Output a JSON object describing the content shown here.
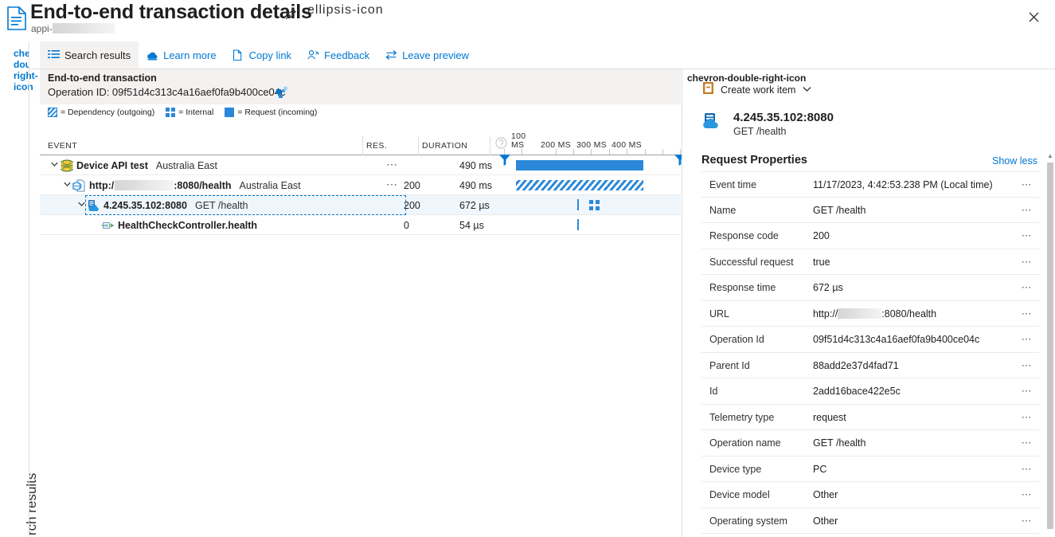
{
  "blade": {
    "title": "End-to-end transaction details",
    "subtitle_prefix": "appi-",
    "doc_icon": "document-icon",
    "pin_icon": "pin-icon",
    "more_icon": "ellipsis-icon",
    "close_icon": "close-icon"
  },
  "left_rail": {
    "expand_icon": "chevron-double-right-icon",
    "vertical_label": "rch results"
  },
  "commandbar": {
    "items": [
      {
        "label": "Search results",
        "icon": "list-icon",
        "active": true
      },
      {
        "label": "Learn more",
        "icon": "cloud-learn-icon",
        "active": false
      },
      {
        "label": "Copy link",
        "icon": "copy-icon",
        "active": false
      },
      {
        "label": "Feedback",
        "icon": "feedback-person-icon",
        "active": false
      },
      {
        "label": "Leave preview",
        "icon": "swap-arrows-icon",
        "active": false
      }
    ]
  },
  "transaction": {
    "heading": "End-to-end transaction",
    "operation_id_label": "Operation ID: 09f51d4c313c4a16aef0fa9b400ce04c",
    "operation_id_copy_icon": "copy-badge-icon",
    "legend": [
      {
        "swatch": "dependency",
        "label": "= Dependency (outgoing)"
      },
      {
        "swatch": "internal",
        "label": "= Internal"
      },
      {
        "swatch": "request",
        "label": "= Request (incoming)"
      }
    ]
  },
  "table": {
    "columns": {
      "event": "EVENT",
      "res": "RES.",
      "duration": "DURATION"
    },
    "search_icon": "search-icon",
    "clock_icon": "clock-icon",
    "filter_icon": "filter-funnel-icon",
    "axis_labels": [
      "100 MS",
      "200 MS",
      "300 MS",
      "400 MS"
    ],
    "rows": [
      {
        "indent": 0,
        "chevron": "⌄",
        "icon": "globe-availability-icon",
        "name": "Device API test",
        "sub": "Australia East",
        "res": "",
        "duration": "490 ms",
        "dots": "⋯",
        "bar_type": "request",
        "selected": false
      },
      {
        "indent": 1,
        "chevron": "⌄",
        "icon": "page-globe-request-icon",
        "name": "http:/  :8080/health",
        "name_prefix": "http:/",
        "name_suffix": ":8080/health",
        "sub": "Australia East",
        "res": "200",
        "duration": "490 ms",
        "dots": "⋯",
        "bar_type": "dependency",
        "selected": false
      },
      {
        "indent": 2,
        "chevron": "⌄",
        "icon": "server-cloud-role-icon",
        "name": "4.245.35.102:8080",
        "sub": "GET /health",
        "res": "200",
        "duration": "672 µs",
        "dots": "",
        "bar_type": "internal-mark",
        "selected": true
      },
      {
        "indent": 3,
        "chevron": "",
        "icon": "internal-trace-icon",
        "name": "HealthCheckController.health",
        "sub": "",
        "res": "0",
        "duration": "54 µs",
        "dots": "",
        "bar_type": "mark",
        "selected": false
      }
    ]
  },
  "details": {
    "expand_icon": "chevron-double-right-icon",
    "create_work_item": {
      "label": "Create work item",
      "icon": "work-item-icon",
      "chevron": "⌄"
    },
    "entity": {
      "icon": "server-cloud-role-icon",
      "title": "4.245.35.102:8080",
      "subtitle": "GET /health"
    },
    "section_title": "Request Properties",
    "show_less": "Show less",
    "row_menu": "⋯",
    "properties": [
      {
        "key": "Event time",
        "value": "11/17/2023, 4:42:53.238 PM (Local time)"
      },
      {
        "key": "Name",
        "value": "GET /health"
      },
      {
        "key": "Response code",
        "value": "200"
      },
      {
        "key": "Successful request",
        "value": "true"
      },
      {
        "key": "Response time",
        "value": "672 µs"
      },
      {
        "key": "URL",
        "value": "http://  :8080/health",
        "value_prefix": "http://",
        "value_suffix": ":8080/health",
        "redacted": true
      },
      {
        "key": "Operation Id",
        "value": "09f51d4c313c4a16aef0fa9b400ce04c"
      },
      {
        "key": "Parent Id",
        "value": "88add2e37d4fad71"
      },
      {
        "key": "Id",
        "value": "2add16bace422e5c"
      },
      {
        "key": "Telemetry type",
        "value": "request"
      },
      {
        "key": "Operation name",
        "value": "GET /health"
      },
      {
        "key": "Device type",
        "value": "PC"
      },
      {
        "key": "Device model",
        "value": "Other"
      },
      {
        "key": "Operating system",
        "value": "Other"
      }
    ]
  },
  "colors": {
    "accent": "#0078d4",
    "bar": "#2b88d8",
    "selection": "#eff6fc",
    "panel": "#f3f2f1",
    "border": "#e1dfdd"
  }
}
